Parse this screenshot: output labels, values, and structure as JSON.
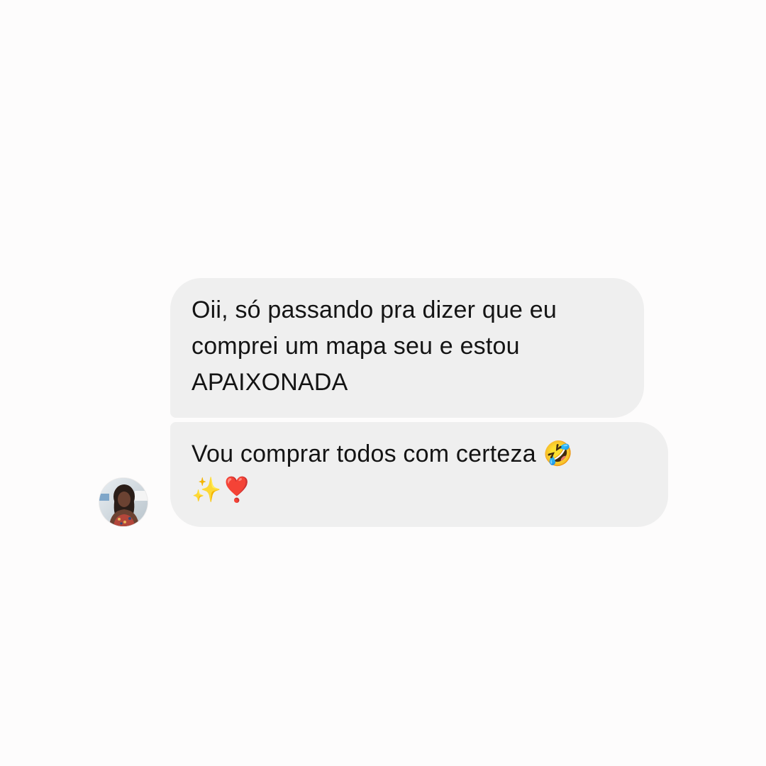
{
  "conversation": {
    "messages": [
      {
        "text": "Oii, só passando pra dizer que eu\ncomprei um mapa seu e estou\nAPAIXONADA"
      },
      {
        "text": "Vou comprar todos com certeza 🤣\n✨❣️"
      }
    ],
    "sender": {
      "avatar_icon": "profile-photo"
    }
  },
  "colors": {
    "background": "#fdfcfc",
    "bubble": "#efefef",
    "text": "#141414"
  }
}
